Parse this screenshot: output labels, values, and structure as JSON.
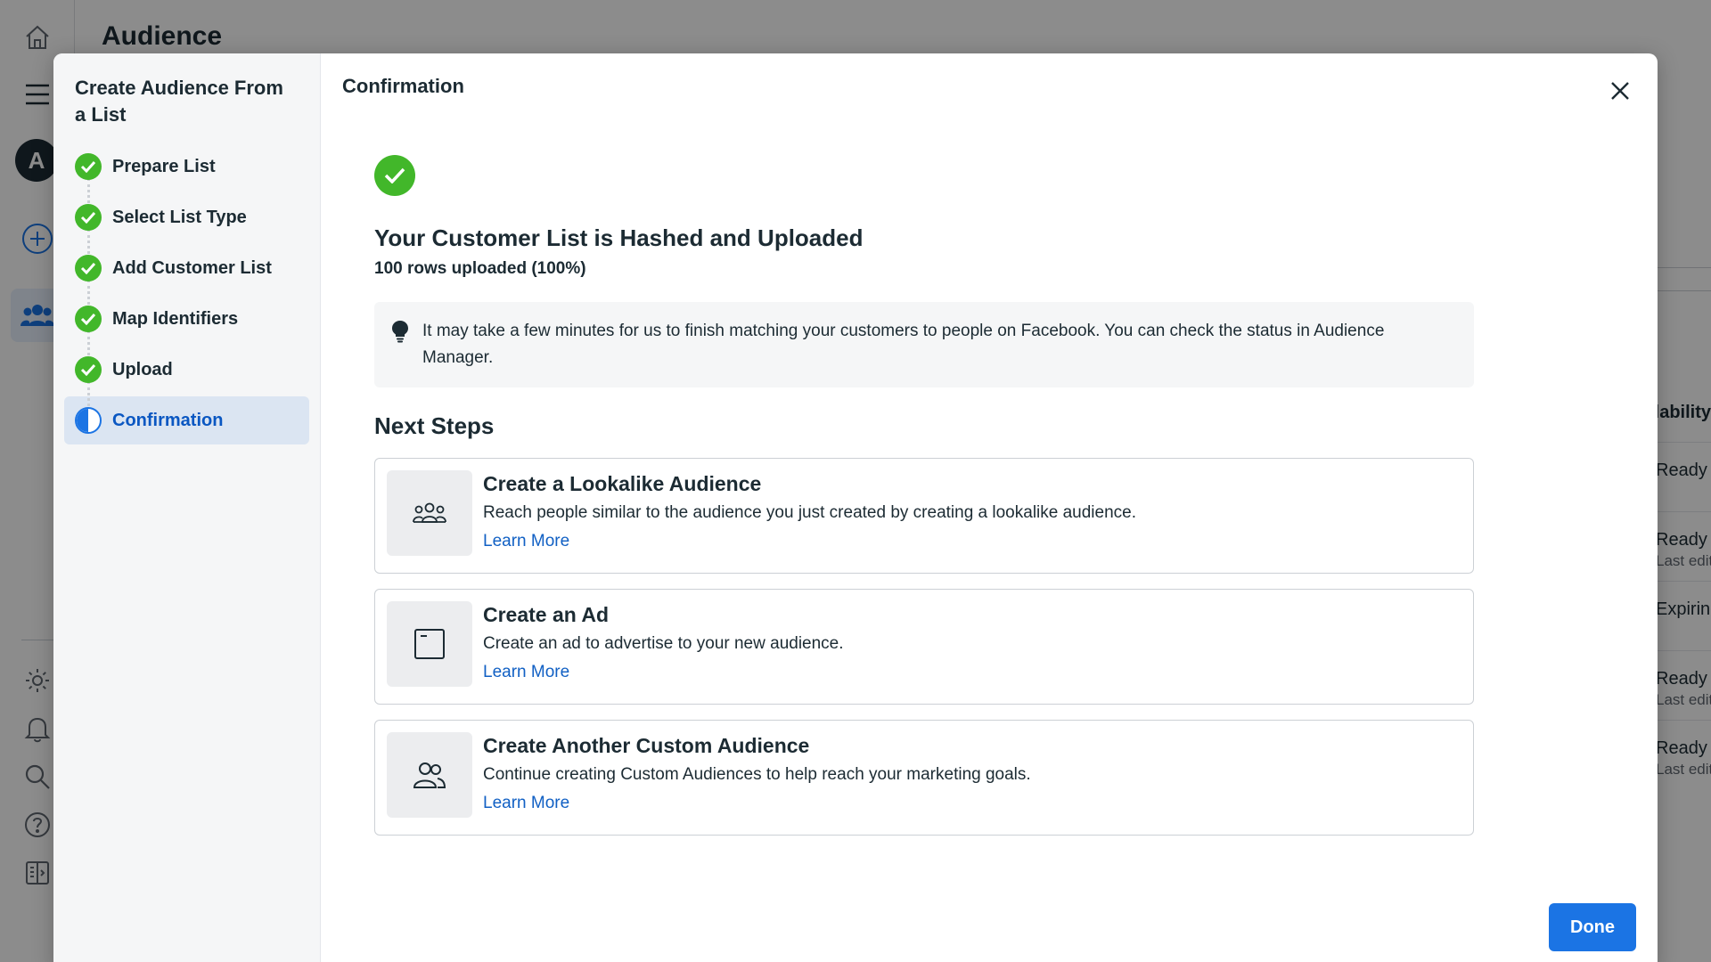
{
  "app": {
    "title": "Audience",
    "rail_avatar_letter": "A"
  },
  "background_table": {
    "column_header": "Availability",
    "rows": [
      {
        "status": "Ready",
        "sub": ""
      },
      {
        "status": "Ready",
        "sub": "Last edited"
      },
      {
        "status": "Expiring",
        "sub": ""
      },
      {
        "status": "Ready",
        "sub": "Last edited"
      },
      {
        "status": "Ready",
        "sub": "Last edited"
      }
    ]
  },
  "modal": {
    "sidebar_title": "Create Audience From a List",
    "steps": [
      {
        "label": "Prepare List",
        "state": "done"
      },
      {
        "label": "Select List Type",
        "state": "done"
      },
      {
        "label": "Add Customer List",
        "state": "done"
      },
      {
        "label": "Map Identifiers",
        "state": "done"
      },
      {
        "label": "Upload",
        "state": "done"
      },
      {
        "label": "Confirmation",
        "state": "current"
      }
    ],
    "header": "Confirmation",
    "heading": "Your Customer List is Hashed and Uploaded",
    "subheading": "100 rows uploaded (100%)",
    "info": "It may take a few minutes for us to finish matching your customers to people on Facebook. You can check the status in Audience Manager.",
    "next_steps_title": "Next Steps",
    "cards": [
      {
        "icon": "group-icon",
        "title": "Create a Lookalike Audience",
        "desc": "Reach people similar to the audience you just created by creating a lookalike audience.",
        "link": "Learn More"
      },
      {
        "icon": "ad-window-icon",
        "title": "Create an Ad",
        "desc": "Create an ad to advertise to your new audience.",
        "link": "Learn More"
      },
      {
        "icon": "people-icon",
        "title": "Create Another Custom Audience",
        "desc": "Continue creating Custom Audiences to help reach your marketing goals.",
        "link": "Learn More"
      }
    ],
    "done_label": "Done"
  },
  "colors": {
    "primary": "#1b74e4",
    "success": "#42b72a",
    "link": "#1160c4"
  }
}
